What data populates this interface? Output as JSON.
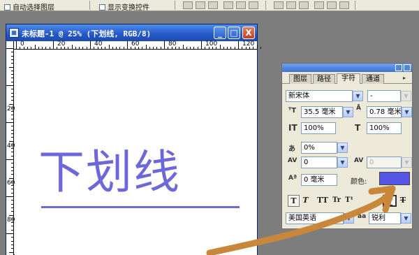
{
  "options_bar": {
    "auto_select": "自动选择图层",
    "show_bounds": "显示变换控件"
  },
  "document": {
    "title": "未标题-1 @ 25% (下划线, RGB/8)",
    "min_glyph": "_",
    "max_glyph": "□",
    "close_glyph": "X",
    "ruler_labels": [
      "0",
      "20",
      "40",
      "60",
      "80",
      "100",
      "120"
    ],
    "text": "下划线"
  },
  "panel": {
    "tabs": [
      "图层",
      "路径",
      "字符",
      "通道"
    ],
    "active_tab": "字符",
    "font_family": "新宋体",
    "font_style": "-",
    "font_size": "35.5 毫米",
    "leading": "0.78 毫米",
    "vertical_scale": "100%",
    "horizontal_scale": "100%",
    "kerning_ratio": "0%",
    "tracking": "0",
    "kerning": "0",
    "baseline_shift": "0 毫米",
    "color_label": "颜色:",
    "text_color": "#5454e5",
    "style_buttons": [
      "T",
      "T",
      "TT",
      "Tr",
      "T¹",
      "T",
      "T"
    ],
    "language": "美国英语",
    "antialias": "aa",
    "antialias_value": "锐利"
  },
  "annotation": {
    "arrow_color": "#c8873a"
  }
}
